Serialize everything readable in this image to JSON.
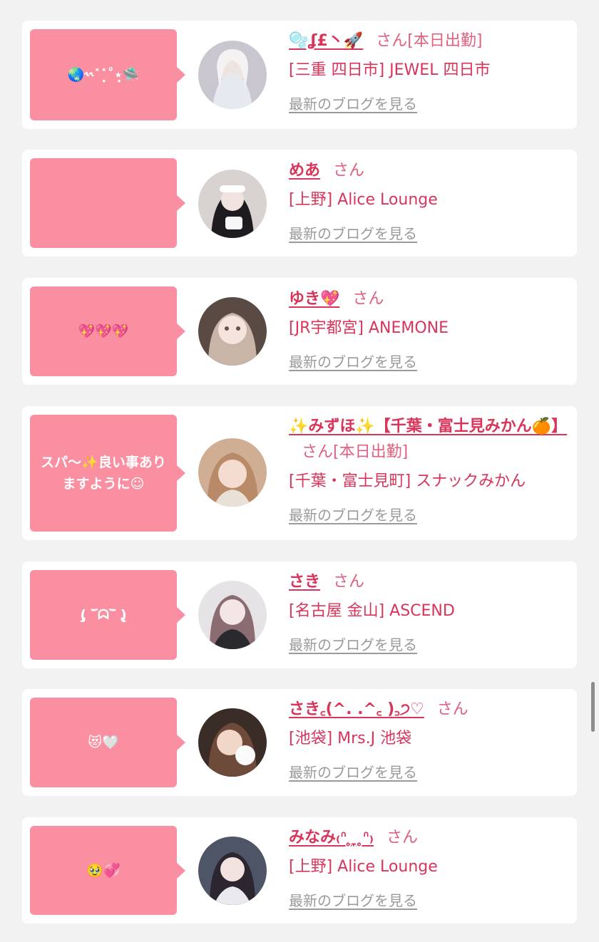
{
  "labels": {
    "san": "さん",
    "shift": "[本日出勤]",
    "blog": "最新のブログを見る"
  },
  "colors": {
    "background": "#f2f2f2",
    "card": "#ffffff",
    "bubble": "#fb8fa2",
    "accent": "#d9345a",
    "muted": "#9a9a9a"
  },
  "cards": [
    {
      "comment": "🌏˞˞˟˟̣̩˚⋆̩̣🛸",
      "name": "🫧ʆ£丶🚀",
      "shift": true,
      "shop": "[三重 四日市] JEWEL 四日市"
    },
    {
      "comment": "",
      "name": "めあ",
      "shift": false,
      "shop": "[上野] Alice Lounge"
    },
    {
      "comment": "💖💖💖",
      "name": "ゆき💖",
      "shift": false,
      "shop": "[JR宇都宮] ANEMONE"
    },
    {
      "comment": "スパ〜✨良い事ありますように☺︎",
      "name": "✨みずほ✨【千葉・富士見みかん🍊】",
      "shift": true,
      "shop": "[千葉・富士見町] スナックみかん"
    },
    {
      "comment": "(̨̡ ‾᷄ᗣ‾᷅ )̧̢",
      "name": "さき",
      "shift": false,
      "shop": "[名古屋 金山] ASCEND"
    },
    {
      "comment": "😻🤍",
      "name": "さき꜀(^. .^꜀ )꜆੭♡",
      "shift": false,
      "shop": "[池袋] Mrs.J 池袋"
    },
    {
      "comment": "🥹💞",
      "name": "みなみ₍ᐢ ̥ ̞ ̥ᐢ₎",
      "shift": false,
      "shop": "[上野] Alice Lounge"
    }
  ]
}
